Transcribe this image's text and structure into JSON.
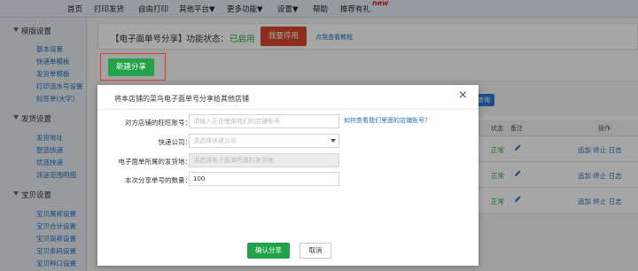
{
  "topnav": {
    "items": [
      "首页",
      "打印发货",
      "自由打印",
      "其他平台▼",
      "更多功能▼",
      "设置▼",
      "帮助",
      "推荐有礼"
    ],
    "new_badge": "new"
  },
  "sidebar": {
    "sections": [
      {
        "label": "模版设置",
        "links": [
          "基本设置",
          "快递单模板",
          "发货单模板",
          "打印流水号设置",
          "标签单(大字)"
        ]
      },
      {
        "label": "发货设置",
        "links": [
          "发货地址",
          "智选快递",
          "优选快递",
          "派送范围明细"
        ]
      },
      {
        "label": "宝贝设置",
        "links": [
          "宝贝属称设置",
          "宝贝合计设置",
          "宝贝简称设置",
          "宝贝条码设置",
          "宝贝种口设置"
        ]
      }
    ]
  },
  "status_bar": {
    "title": "【电子面单号分享】功能状态：",
    "state": "已启用",
    "stop_button": "我要停用",
    "tutorial_link": "点我查看教程"
  },
  "toolbar": {
    "new_share_button": "新建分享"
  },
  "background_table": {
    "headers": [
      "状态",
      "备注",
      "操作"
    ],
    "rows": [
      {
        "status": "正常",
        "ops": "追加 终止 日志"
      },
      {
        "status": "正常",
        "ops": "追加 终止 日志"
      },
      {
        "status": "正常",
        "ops": "追加 终止 日志"
      }
    ],
    "query_button": "查询"
  },
  "modal": {
    "title": "将本店铺的菜鸟电子面单号分享给其他店铺",
    "close_icon": "×",
    "fields": [
      {
        "label": "对方店铺的旺旺账号：",
        "placeholder": "请输入正在使用我们的店铺账号",
        "value": ""
      },
      {
        "label": "快递公司：",
        "placeholder": "请选择快递公司",
        "value": ""
      },
      {
        "label": "电子面单所属的发货地：",
        "placeholder": "请选择电子面单所属的发货地",
        "value": ""
      },
      {
        "label": "本次分享单号的数量：",
        "placeholder": "",
        "value": "100"
      }
    ],
    "help_link": "如何查看我们里面的店铺账号？",
    "confirm_button": "确认分享",
    "cancel_button": "取消"
  },
  "colors": {
    "accent_green": "#22a249",
    "stop_red": "#d9472b",
    "link_blue": "#2a6fb8",
    "highlight_red": "#e03a2a"
  }
}
